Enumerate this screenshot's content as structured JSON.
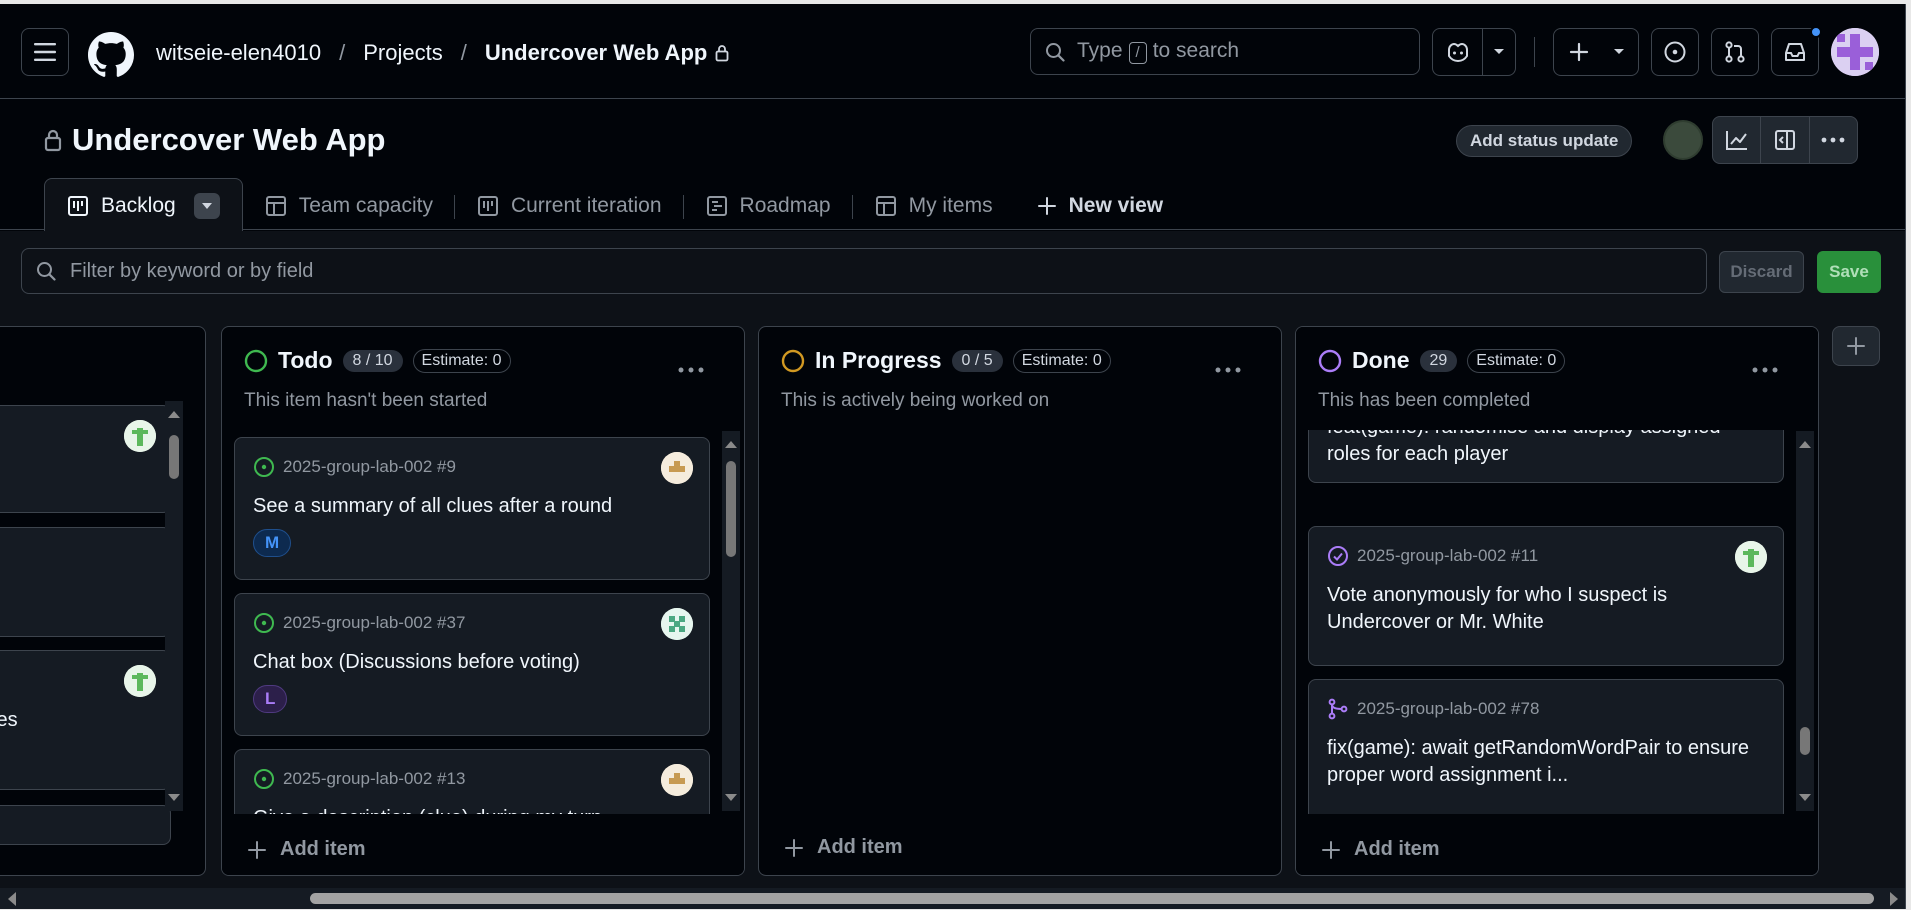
{
  "header": {
    "breadcrumbs": {
      "owner": "witseie-elen4010",
      "projects": "Projects",
      "project": "Undercover Web App",
      "separator": "/"
    },
    "search": {
      "prefix": "Type",
      "key": "/",
      "suffix": "to search"
    }
  },
  "project": {
    "title": "Undercover Web App",
    "status_update_label": "Add status update",
    "tabs": [
      {
        "label": "Backlog",
        "icon": "board-icon",
        "active": true
      },
      {
        "label": "Team capacity",
        "icon": "table-icon"
      },
      {
        "label": "Current iteration",
        "icon": "board-icon"
      },
      {
        "label": "Roadmap",
        "icon": "roadmap-icon"
      },
      {
        "label": "My items",
        "icon": "table-icon"
      }
    ],
    "new_view_label": "New view"
  },
  "filter": {
    "placeholder": "Filter by keyword or by field",
    "discard_label": "Discard",
    "save_label": "Save"
  },
  "partial_column": {
    "visible_text": "ices"
  },
  "columns": [
    {
      "name": "Todo",
      "count": "8 / 10",
      "estimate": "Estimate: 0",
      "description": "This item hasn't been started",
      "status_color": "#3fb950",
      "add_item_label": "Add item",
      "cards": [
        {
          "ref": "2025-group-lab-002 #9",
          "title": "See a summary of all clues after a round",
          "label": "M",
          "label_color": "#4493f8",
          "icon": "issue-open-icon"
        },
        {
          "ref": "2025-group-lab-002 #37",
          "title": "Chat box (Discussions before voting)",
          "label": "L",
          "label_color": "#ab7df8",
          "icon": "issue-open-icon"
        },
        {
          "ref": "2025-group-lab-002 #13",
          "title": "Give a description (clue) during my turn",
          "icon": "issue-open-icon"
        }
      ]
    },
    {
      "name": "In Progress",
      "count": "0 / 5",
      "estimate": "Estimate: 0",
      "description": "This is actively being worked on",
      "status_color": "#d29922",
      "add_item_label": "Add item",
      "cards": []
    },
    {
      "name": "Done",
      "count": "29",
      "estimate": "Estimate: 0",
      "description": "This has been completed",
      "status_color": "#ab7df8",
      "add_item_label": "Add item",
      "cards": [
        {
          "title": "feat(game): randomise and display assigned roles for each player"
        },
        {
          "ref": "2025-group-lab-002 #11",
          "title": "Vote anonymously for who I suspect is Undercover or Mr. White",
          "icon": "issue-closed-icon"
        },
        {
          "ref": "2025-group-lab-002 #78",
          "title": "fix(game): await getRandomWordPair to ensure proper word assignment i...",
          "icon": "pull-request-merged-icon"
        }
      ]
    }
  ],
  "colors": {
    "background": "#010409",
    "board_background": "#0d1117",
    "card_background": "#151b23",
    "border": "#3d444d",
    "accent_blue": "#4493f8",
    "save_green": "#29903b"
  }
}
